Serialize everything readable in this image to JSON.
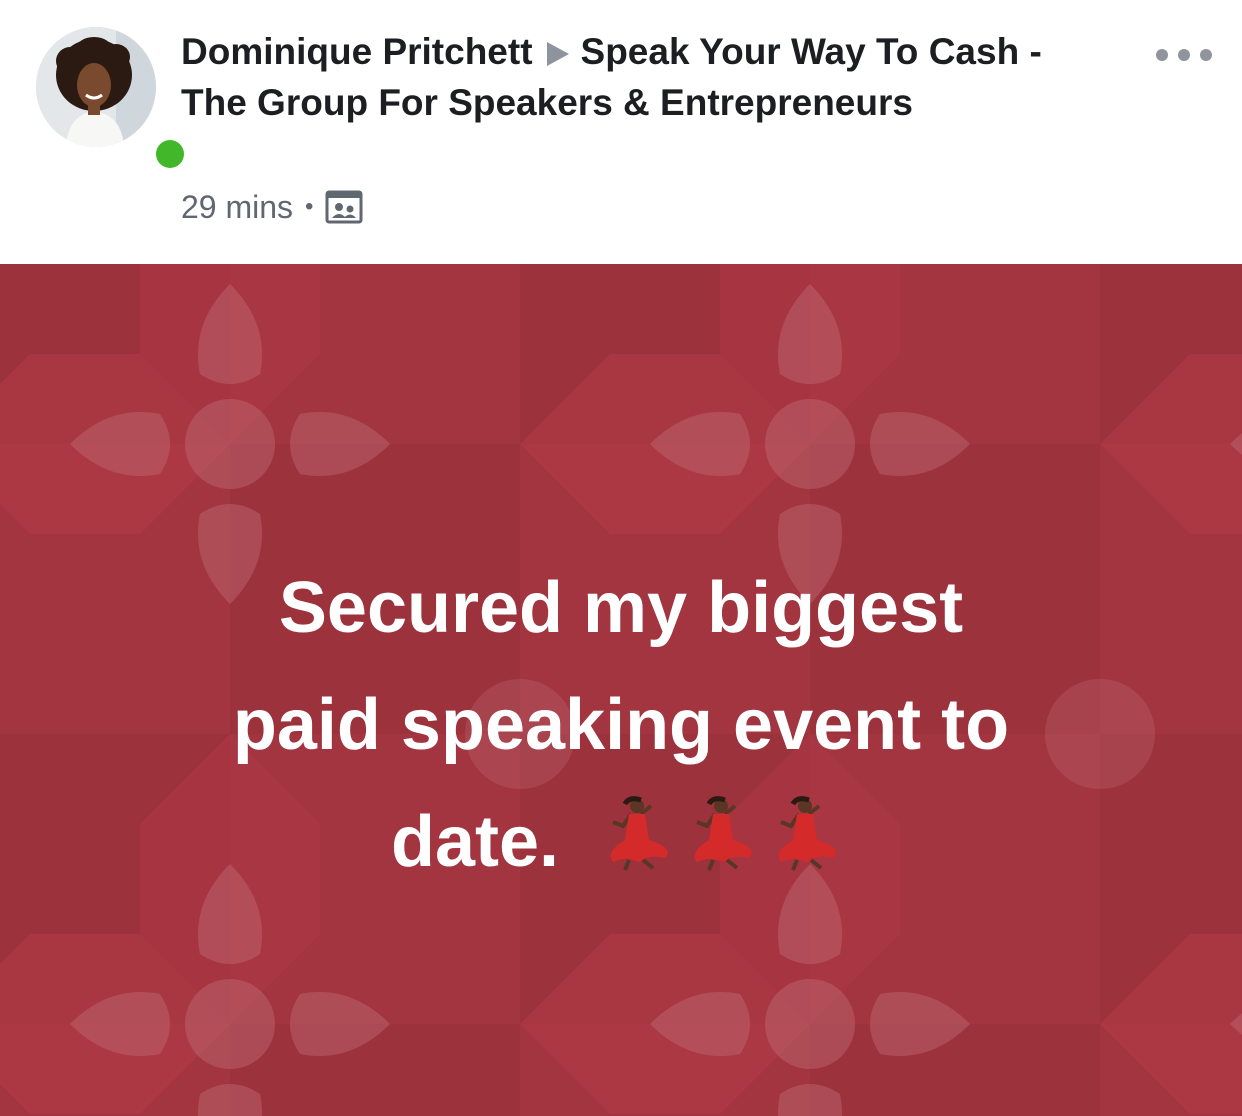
{
  "post": {
    "author": "Dominique Pritchett",
    "group": "Speak Your Way To Cash - The Group For Speakers & Entrepreneurs",
    "timestamp": "29 mins",
    "audience_icon": "group-icon",
    "online": true,
    "menu_icon": "more-options-icon"
  },
  "status": {
    "lines": [
      "Secured my biggest",
      "paid speaking event to",
      "date."
    ],
    "emojis": [
      "dancer-icon",
      "dancer-icon",
      "dancer-icon"
    ],
    "background_color": "#a2353f"
  },
  "colors": {
    "online": "#42b72a",
    "header_text": "#1c1e21",
    "meta_text": "#616770"
  }
}
